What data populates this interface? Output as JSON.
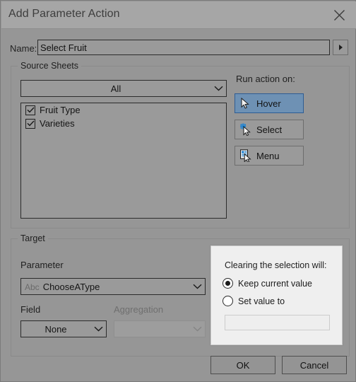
{
  "window": {
    "title": "Add Parameter Action",
    "close_icon": "close-icon"
  },
  "name_row": {
    "label": "Name:",
    "value": "Select Fruit",
    "placeholder": "",
    "expand_icon": "triangle-right-icon"
  },
  "source_sheets": {
    "legend": "Source Sheets",
    "sheet_scope": {
      "selected": "All",
      "chevron_icon": "chevron-down-icon"
    },
    "sheets": [
      {
        "label": "Fruit Type",
        "checked": true
      },
      {
        "label": "Varieties",
        "checked": true
      }
    ]
  },
  "run_action_on": {
    "label": "Run action on:",
    "buttons": [
      {
        "label": "Hover",
        "icon": "cursor-arrow-icon",
        "selected": true
      },
      {
        "label": "Select",
        "icon": "cursor-select-sparkle-icon",
        "selected": false
      },
      {
        "label": "Menu",
        "icon": "cursor-menu-list-icon",
        "selected": false
      }
    ]
  },
  "target": {
    "legend": "Target",
    "parameter_label": "Parameter",
    "parameter": {
      "type_prefix": "Abc",
      "value": "ChooseAType",
      "chevron_icon": "chevron-down-icon"
    },
    "field_label": "Field",
    "field": {
      "value": "None",
      "chevron_icon": "chevron-down-icon"
    },
    "aggregation_label": "Aggregation",
    "aggregation": {
      "value": "",
      "chevron_icon": "chevron-down-icon",
      "disabled": true
    }
  },
  "clearing_popup": {
    "title": "Clearing the selection will:",
    "options": [
      {
        "label": "Keep current value",
        "selected": true
      },
      {
        "label": "Set value to",
        "selected": false
      }
    ],
    "value_input": {
      "value": "",
      "placeholder": ""
    }
  },
  "footer": {
    "ok_label": "OK",
    "cancel_label": "Cancel"
  },
  "colors": {
    "dialog_background": "#969696",
    "titlebar_background": "#a6a6a6",
    "selected_button_fill": "#6e91b4",
    "selected_button_border": "#2e5d94",
    "popup_background": "#efefef",
    "accent_blue": "#1c84d6"
  }
}
